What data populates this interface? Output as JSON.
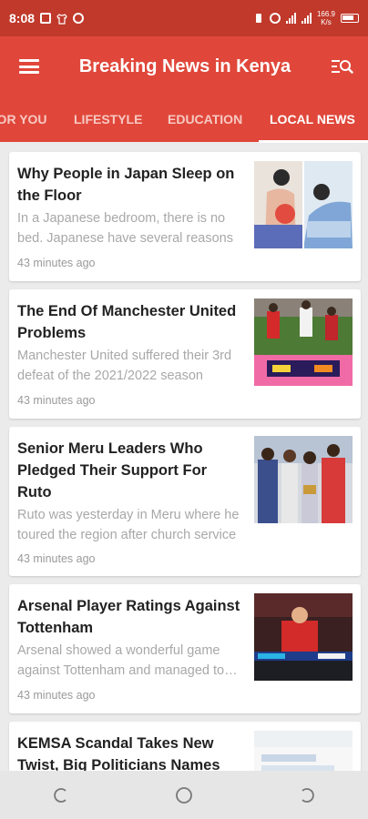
{
  "status_bar": {
    "time": "8:08",
    "left_icons": [
      "facebook-icon",
      "shirt-icon",
      "block-icon"
    ],
    "net_speed_value": "166.9",
    "net_speed_unit": "K/s",
    "right_icons": [
      "vibrate-icon",
      "hotspot-icon",
      "signal-icon",
      "signal-icon",
      "battery-icon"
    ]
  },
  "app_bar": {
    "title": "Breaking News in Kenya",
    "menu_icon": "hamburger-menu-icon",
    "search_icon": "search-list-icon",
    "color": "#e0473a"
  },
  "tabs": [
    {
      "label": "For You",
      "active": false
    },
    {
      "label": "Lifestyle",
      "active": false
    },
    {
      "label": "Education",
      "active": false
    },
    {
      "label": "Local News",
      "active": true
    }
  ],
  "articles": [
    {
      "title": "Why People in Japan Sleep on the Floor",
      "excerpt": "In a Japanese bedroom, there is no bed. Japanese have several reasons",
      "time": "43 minutes ago",
      "thumbnail": "illustration-back-pain-sleeping"
    },
    {
      "title": "The End Of Manchester United Problems",
      "excerpt": "Manchester United suffered their 3rd defeat of the 2021/2022 season",
      "time": "43 minutes ago",
      "thumbnail": "football-match-photo"
    },
    {
      "title": "Senior Meru Leaders Who Pledged Their Support For Ruto",
      "excerpt": "Ruto was yesterday in Meru where he toured the region after church service",
      "time": "43 minutes ago",
      "thumbnail": "politicians-group-photo"
    },
    {
      "title": "Arsenal Player Ratings Against Tottenham",
      "excerpt": "Arsenal showed a wonderful game against Tottenham and managed to win",
      "time": "43 minutes ago",
      "thumbnail": "arsenal-player-photo"
    },
    {
      "title": "KEMSA Scandal Takes New Twist, Big Politicians Names",
      "excerpt": "",
      "time": "",
      "thumbnail": "building-sign-photo"
    }
  ],
  "nav_bar": {
    "buttons": [
      "recent-apps-icon",
      "home-icon",
      "back-icon"
    ]
  }
}
